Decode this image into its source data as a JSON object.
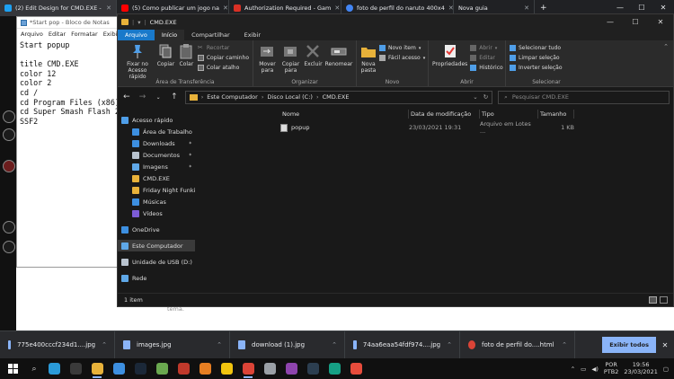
{
  "browser": {
    "tabs": [
      {
        "label": "(2) Edit Design for CMD.EXE -",
        "color": "#1da1f2",
        "active": true
      },
      {
        "label": "(5) Como publicar um jogo na",
        "color": "#ff0000"
      },
      {
        "label": "Authorization Required - Gam",
        "color": "#d93025"
      },
      {
        "label": "foto de perfil do naruto 400x4",
        "color": "#4285f4"
      },
      {
        "label": "Nova guia",
        "color": "#9aa0a6"
      }
    ],
    "controls": {
      "minimize": "—",
      "maximize": "☐",
      "close": "✕"
    }
  },
  "page": {
    "caption": "tema."
  },
  "notepad": {
    "title": "*Start pop - Bloco de Notas",
    "menu": [
      "Arquivo",
      "Editar",
      "Formatar",
      "Exibir"
    ],
    "content": "Start popup\n\ntitle CMD.EXE\ncolor 12\ncolor 2\ncd /\ncd Program Files (x86)\ncd Super Smash Flash 2 Be\nSSF2"
  },
  "explorer": {
    "title": "CMD.EXE",
    "ribbon_tabs": [
      "Arquivo",
      "Início",
      "Compartilhar",
      "Exibir"
    ],
    "ribbon": {
      "clipboard": {
        "pin_label": "Fixar no Acesso rápido",
        "copy_label": "Copiar",
        "paste_label": "Colar",
        "cut_label": "Recortar",
        "copy_path_label": "Copiar caminho",
        "paste_shortcut_label": "Colar atalho",
        "group_label": "Área de Transferência"
      },
      "organize": {
        "move_label": "Mover para",
        "copy_to_label": "Copiar para",
        "delete_label": "Excluir",
        "rename_label": "Renomear",
        "group_label": "Organizar"
      },
      "new": {
        "new_folder_label": "Nova pasta",
        "new_item_label": "Novo item",
        "easy_access_label": "Fácil acesso",
        "group_label": "Novo"
      },
      "open": {
        "properties_label": "Propriedades",
        "open_label": "Abrir",
        "edit_label": "Editar",
        "history_label": "Histórico",
        "group_label": "Abrir"
      },
      "select": {
        "select_all_label": "Selecionar tudo",
        "clear_selection_label": "Limpar seleção",
        "invert_selection_label": "Inverter seleção",
        "group_label": "Selecionar"
      }
    },
    "address": {
      "crumbs": [
        "Este Computador",
        "Disco Local (C:)",
        "CMD.EXE"
      ],
      "search_placeholder": "Pesquisar CMD.EXE"
    },
    "nav": [
      {
        "label": "Acesso rápido",
        "icon": "star-icon",
        "color": "#4f9ee8",
        "child": false,
        "pin": false
      },
      {
        "label": "Área de Trabalho",
        "icon": "desktop-icon",
        "color": "#3d8fe0",
        "child": true,
        "pin": true
      },
      {
        "label": "Downloads",
        "icon": "download-icon",
        "color": "#3d8fe0",
        "child": true,
        "pin": true
      },
      {
        "label": "Documentos",
        "icon": "document-icon",
        "color": "#b9c3cf",
        "child": true,
        "pin": true
      },
      {
        "label": "Imagens",
        "icon": "image-icon",
        "color": "#5fa8e8",
        "child": true,
        "pin": true
      },
      {
        "label": "CMD.EXE",
        "icon": "folder-icon",
        "color": "#e8b23a",
        "child": true,
        "pin": false
      },
      {
        "label": "Friday Night Funkin",
        "icon": "folder-icon",
        "color": "#e8b23a",
        "child": true,
        "pin": false
      },
      {
        "label": "Músicas",
        "icon": "music-icon",
        "color": "#3d8fe0",
        "child": true,
        "pin": false
      },
      {
        "label": "Vídeos",
        "icon": "video-icon",
        "color": "#7c5cd6",
        "child": true,
        "pin": false
      },
      {
        "gap": true
      },
      {
        "label": "OneDrive",
        "icon": "cloud-icon",
        "color": "#3d8fe0",
        "child": false,
        "pin": false
      },
      {
        "gap": true
      },
      {
        "label": "Este Computador",
        "icon": "computer-icon",
        "color": "#5fa8e8",
        "child": false,
        "pin": false,
        "selected": true
      },
      {
        "gap": true
      },
      {
        "label": "Unidade de USB (D:)",
        "icon": "usb-drive-icon",
        "color": "#b9c3cf",
        "child": false,
        "pin": false
      },
      {
        "gap": true
      },
      {
        "label": "Rede",
        "icon": "network-icon",
        "color": "#5fa8e8",
        "child": false,
        "pin": false
      }
    ],
    "columns": {
      "name": "Nome",
      "date": "Data de modificação",
      "type": "Tipo",
      "size": "Tamanho"
    },
    "files": [
      {
        "name": "popup",
        "date": "23/03/2021 19:31",
        "type": "Arquivo em Lotes ...",
        "size": "1 KB"
      }
    ],
    "status": "1 item"
  },
  "downloads": {
    "items": [
      "775e400cccf234d1....jpg",
      "images.jpg",
      "download (1).jpg",
      "74aa6eaa54fdf974....jpg",
      "foto de perfil do....html"
    ],
    "show_all": "Exibir todos",
    "close": "✕"
  },
  "taskbar": {
    "apps": [
      {
        "icon": "edge-icon",
        "color": "#2a9ad8",
        "running": false
      },
      {
        "icon": "task-view-icon",
        "color": "#3a3a3a",
        "running": false
      },
      {
        "icon": "file-explorer-icon",
        "color": "#e8b23a",
        "running": true
      },
      {
        "icon": "store-icon",
        "color": "#3d8fe0",
        "running": false
      },
      {
        "icon": "steam-icon",
        "color": "#1b2838",
        "running": false
      },
      {
        "icon": "minecraft-icon",
        "color": "#6aa84f",
        "running": false
      },
      {
        "icon": "game-icon",
        "color": "#c0392b",
        "running": false
      },
      {
        "icon": "game-icon-2",
        "color": "#e67e22",
        "running": false
      },
      {
        "icon": "colorful-app-icon",
        "color": "#f1c40f",
        "running": false
      },
      {
        "icon": "chrome-icon",
        "color": "#db4437",
        "running": true
      },
      {
        "icon": "settings-icon",
        "color": "#9aa0a6",
        "running": false
      },
      {
        "icon": "app-icon",
        "color": "#8e44ad",
        "running": false
      },
      {
        "icon": "app-icon-2",
        "color": "#2c3e50",
        "running": false
      },
      {
        "icon": "app-icon-3",
        "color": "#16a085",
        "running": false
      },
      {
        "icon": "app-icon-4",
        "color": "#e74c3c",
        "running": false
      }
    ],
    "lang_top": "POR",
    "lang_bottom": "PTB2",
    "time": "19:56",
    "date": "23/03/2021"
  }
}
